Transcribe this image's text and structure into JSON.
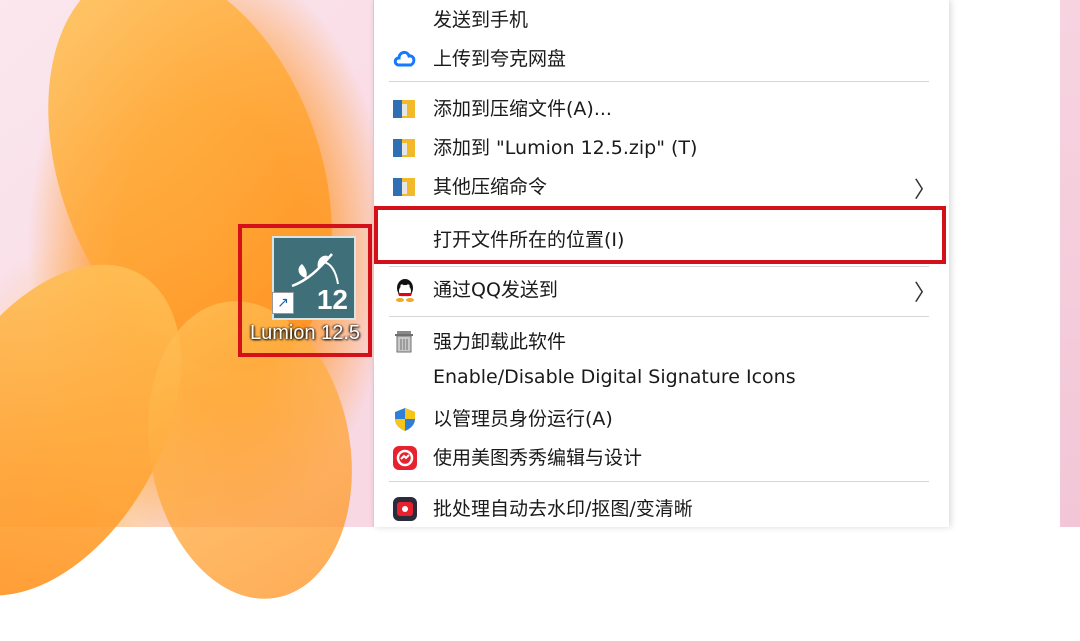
{
  "desktop": {
    "icon_label": "Lumion 12.5",
    "icon_badge": "12",
    "shortcut_glyph": "↗"
  },
  "menu": {
    "items": [
      {
        "label": "发送到手机",
        "icon": "none",
        "submenu": false
      },
      {
        "label": "上传到夸克网盘",
        "icon": "cloud-icon",
        "submenu": false
      },
      {
        "label": "添加到压缩文件(A)...",
        "icon": "archive-icon",
        "submenu": false
      },
      {
        "label": "添加到 \"Lumion 12.5.zip\" (T)",
        "icon": "archive-icon",
        "submenu": false
      },
      {
        "label": "其他压缩命令",
        "icon": "archive-icon",
        "submenu": true
      },
      {
        "label": "打开文件所在的位置(I)",
        "icon": "none",
        "submenu": false,
        "highlighted": true
      },
      {
        "label": "通过QQ发送到",
        "icon": "qq-icon",
        "submenu": true
      },
      {
        "label": "强力卸载此软件",
        "icon": "trash-icon",
        "submenu": false
      },
      {
        "label": "Enable/Disable Digital Signature Icons",
        "icon": "none",
        "submenu": false
      },
      {
        "label": "以管理员身份运行(A)",
        "icon": "shield-icon",
        "submenu": false
      },
      {
        "label": "使用美图秀秀编辑与设计",
        "icon": "meitu-icon",
        "submenu": false
      },
      {
        "label": "批处理自动去水印/抠图/变清晰",
        "icon": "batch-icon",
        "submenu": false
      }
    ],
    "chevron": "〉"
  },
  "colors": {
    "highlight_border": "#d4101a",
    "lumion_tile": "#3f6f78",
    "cloud": "#1677ff"
  }
}
